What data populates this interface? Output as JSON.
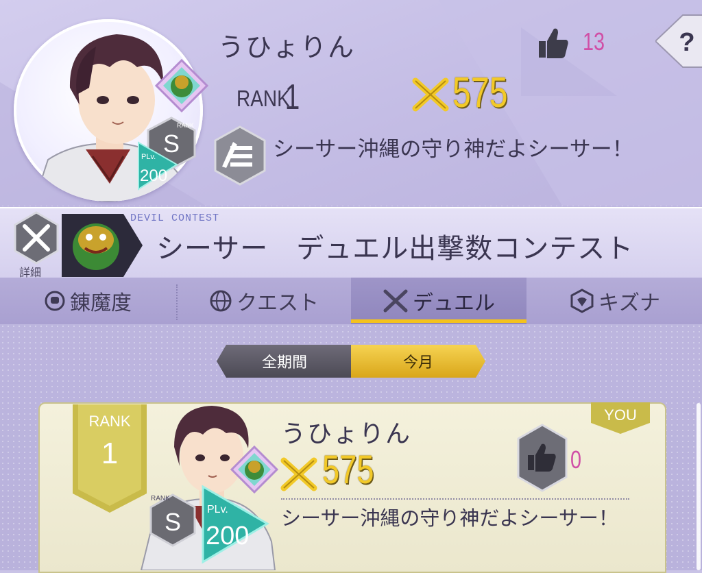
{
  "profile": {
    "name": "うひょりん",
    "rank_label": "RANK",
    "rank_value": "1",
    "power": "575",
    "likes": "13",
    "comment": "シーサー沖縄の守り神だよシーサー！",
    "grade": "S",
    "grade_label": "RANK",
    "level_label": "PLv.",
    "level": "200",
    "help": "?"
  },
  "contest": {
    "detail_label": "詳細",
    "subtitle": "DEVIL CONTEST",
    "title": "シーサー　デュエル出撃数コンテスト"
  },
  "tabs": [
    {
      "label": "錬魔度",
      "icon": "helmet-icon",
      "active": false
    },
    {
      "label": "クエスト",
      "icon": "globe-icon",
      "active": false
    },
    {
      "label": "デュエル",
      "icon": "crossed-swords-icon",
      "active": true
    },
    {
      "label": "キズナ",
      "icon": "bond-icon",
      "active": false
    }
  ],
  "period": {
    "all": "全期間",
    "month": "今月",
    "selected": "今月"
  },
  "ranking": {
    "rank_label": "RANK",
    "rank_value": "1",
    "name": "うひょりん",
    "power": "575",
    "likes": "0",
    "you_label": "YOU",
    "comment": "シーサー沖縄の守り神だよシーサー！",
    "grade": "S",
    "grade_label": "RANK",
    "level_label": "PLv.",
    "level": "200"
  },
  "colors": {
    "accent_gold": "#f2c928",
    "like_pink": "#d04fa6",
    "tab_underline": "#f4c21c",
    "level_teal": "#2fb3a5"
  }
}
